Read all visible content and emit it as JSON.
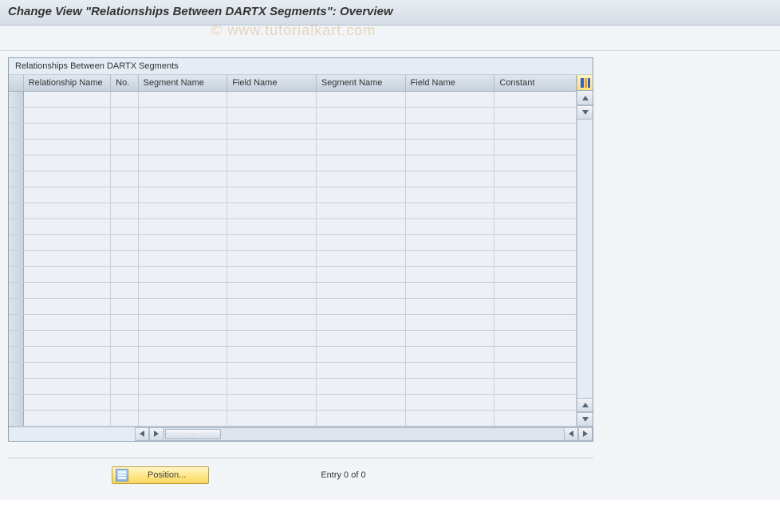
{
  "header": {
    "title": "Change View \"Relationships Between DARTX Segments\": Overview"
  },
  "watermark": "© www.tutorialkart.com",
  "table": {
    "title": "Relationships Between DARTX Segments",
    "columns": [
      "Relationship Name",
      "No.",
      "Segment Name",
      "Field Name",
      "Segment Name",
      "Field Name",
      "Constant"
    ],
    "rows": [
      {},
      {},
      {},
      {},
      {},
      {},
      {},
      {},
      {},
      {},
      {},
      {},
      {},
      {},
      {},
      {},
      {},
      {},
      {},
      {},
      {}
    ]
  },
  "footer": {
    "position_label": "Position...",
    "entry_text": "Entry 0 of 0"
  }
}
